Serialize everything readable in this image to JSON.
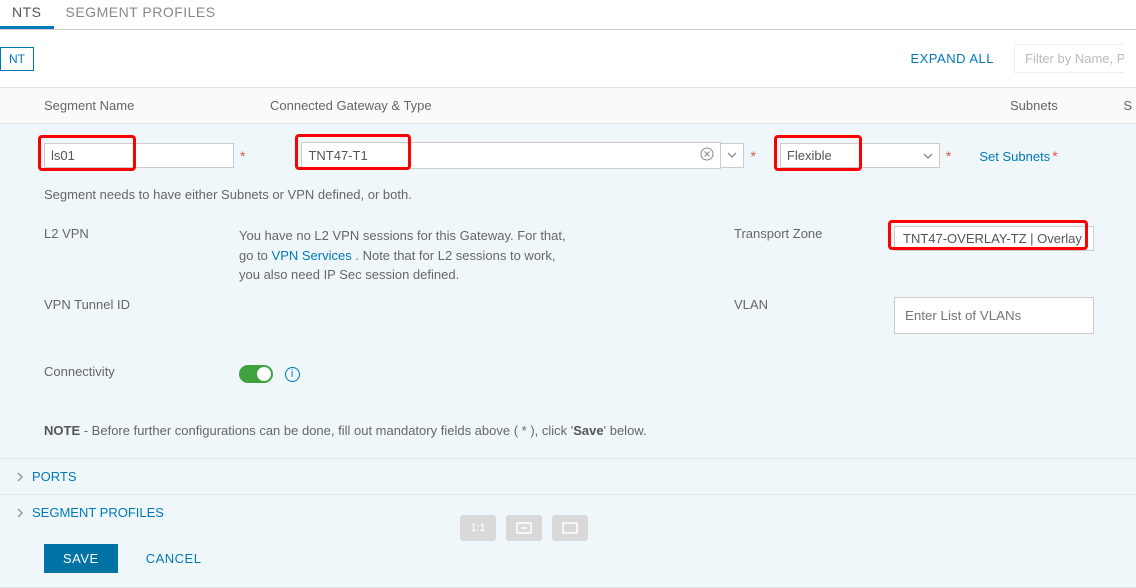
{
  "tabs": {
    "segments": "NTS",
    "profiles": "SEGMENT PROFILES"
  },
  "toolbar": {
    "nt": "NT",
    "expand_all": "EXPAND ALL",
    "filter_placeholder": "Filter by Name, Path o"
  },
  "colhdr": {
    "name": "Segment Name",
    "gw": "Connected Gateway & Type",
    "subnets": "Subnets",
    "s": "S"
  },
  "form": {
    "segment_name": "ls01",
    "gateway": "TNT47-T1",
    "type": "Flexible",
    "set_subnets": "Set Subnets",
    "note": "Segment needs to have either Subnets or VPN defined, or both.",
    "l2vpn_label": "L2 VPN",
    "l2vpn_text_a": "You have no L2 VPN sessions for this Gateway. For that, go to ",
    "l2vpn_link": "VPN Services",
    "l2vpn_text_b": " . Note that for L2 sessions to work, you also need IP Sec session defined.",
    "vpn_tunnel_label": "VPN Tunnel ID",
    "transport_zone_label": "Transport Zone",
    "transport_zone_value": "TNT47-OVERLAY-TZ | Overlay",
    "vlan_label": "VLAN",
    "vlan_placeholder": "Enter List of VLANs",
    "connectivity_label": "Connectivity",
    "note2_prefix": "NOTE",
    "note2_body": " - Before further configurations can be done, fill out mandatory fields above ( * ), click '",
    "note2_save": "Save",
    "note2_suffix": "' below."
  },
  "expanders": {
    "ports": "PORTS",
    "profiles": "SEGMENT PROFILES"
  },
  "footer": {
    "save": "SAVE",
    "cancel": "CANCEL"
  },
  "zoom": {
    "one_to_one": "1:1"
  },
  "icons": {
    "clear": "x",
    "info": "i"
  }
}
